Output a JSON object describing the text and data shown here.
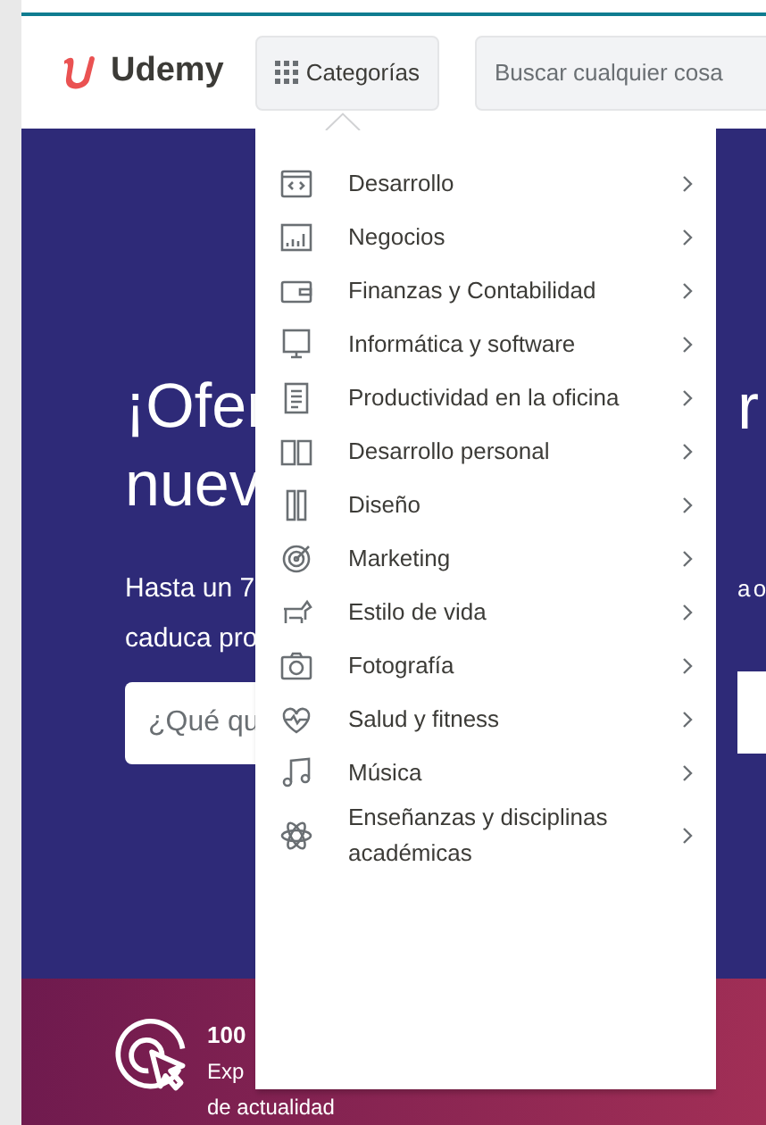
{
  "header": {
    "logo": "Udemy",
    "categories_button": "Categorías",
    "search": {
      "placeholder": "Buscar cualquier cosa"
    }
  },
  "hero": {
    "title_lines": [
      "¡Ofer",
      "nuev"
    ],
    "title_right": "r",
    "subtitle_lines": [
      "Hasta un 7",
      "caduca pro"
    ],
    "subtitle_right": "a o",
    "search": {
      "placeholder": "¿Qué qu"
    }
  },
  "feature": {
    "title": "100",
    "text_lines": [
      "Exp",
      "de actualidad"
    ]
  },
  "menu": {
    "items": [
      {
        "label": "Desarrollo",
        "kind": "code"
      },
      {
        "label": "Negocios",
        "kind": "chart"
      },
      {
        "label": "Finanzas y Contabilidad",
        "kind": "wallet"
      },
      {
        "label": "Informática y software",
        "kind": "monitor"
      },
      {
        "label": "Productividad en la oficina",
        "kind": "clipboard"
      },
      {
        "label": "Desarrollo personal",
        "kind": "book"
      },
      {
        "label": "Diseño",
        "kind": "pencils"
      },
      {
        "label": "Marketing",
        "kind": "target"
      },
      {
        "label": "Estilo de vida",
        "kind": "dog"
      },
      {
        "label": "Fotografía",
        "kind": "camera"
      },
      {
        "label": "Salud y fitness",
        "kind": "heart"
      },
      {
        "label": "Música",
        "kind": "note"
      },
      {
        "label": "Enseñanzas y disciplinas académicas",
        "kind": "atom"
      }
    ]
  }
}
